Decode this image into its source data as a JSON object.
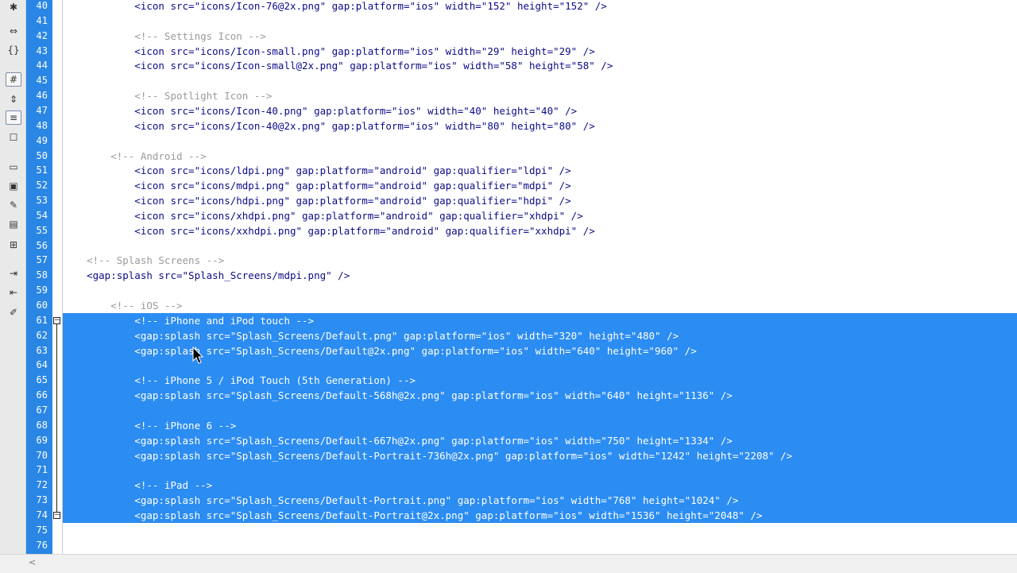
{
  "toolbar": {
    "icons": [
      "asterisk-icon",
      "collapse-tag-icon",
      "braces-icon",
      "line-numbers-icon",
      "collapse-icon",
      "word-wrap-icon",
      "syntax-check-icon",
      "comment-icon",
      "uncomment-icon",
      "highlight-icon",
      "wrap-tag-icon",
      "recent-snippets-icon",
      "indent-icon",
      "outdent-icon",
      "format-source-icon"
    ]
  },
  "editor": {
    "lines": [
      {
        "n": "40",
        "text": "            <icon src=\"icons/Icon-76@2x.png\" gap:platform=\"ios\" width=\"152\" height=\"152\" />",
        "kind": "code",
        "sel": false
      },
      {
        "n": "41",
        "text": "",
        "kind": "code",
        "sel": false
      },
      {
        "n": "42",
        "text": "            <!-- Settings Icon -->",
        "kind": "comment",
        "sel": false
      },
      {
        "n": "43",
        "text": "            <icon src=\"icons/Icon-small.png\" gap:platform=\"ios\" width=\"29\" height=\"29\" />",
        "kind": "code",
        "sel": false
      },
      {
        "n": "44",
        "text": "            <icon src=\"icons/Icon-small@2x.png\" gap:platform=\"ios\" width=\"58\" height=\"58\" />",
        "kind": "code",
        "sel": false
      },
      {
        "n": "45",
        "text": "",
        "kind": "code",
        "sel": false
      },
      {
        "n": "46",
        "text": "            <!-- Spotlight Icon -->",
        "kind": "comment",
        "sel": false
      },
      {
        "n": "47",
        "text": "            <icon src=\"icons/Icon-40.png\" gap:platform=\"ios\" width=\"40\" height=\"40\" />",
        "kind": "code",
        "sel": false
      },
      {
        "n": "48",
        "text": "            <icon src=\"icons/Icon-40@2x.png\" gap:platform=\"ios\" width=\"80\" height=\"80\" />",
        "kind": "code",
        "sel": false
      },
      {
        "n": "49",
        "text": "",
        "kind": "code",
        "sel": false
      },
      {
        "n": "50",
        "text": "        <!-- Android -->",
        "kind": "comment",
        "sel": false
      },
      {
        "n": "51",
        "text": "            <icon src=\"icons/ldpi.png\" gap:platform=\"android\" gap:qualifier=\"ldpi\" />",
        "kind": "code",
        "sel": false
      },
      {
        "n": "52",
        "text": "            <icon src=\"icons/mdpi.png\" gap:platform=\"android\" gap:qualifier=\"mdpi\" />",
        "kind": "code",
        "sel": false
      },
      {
        "n": "53",
        "text": "            <icon src=\"icons/hdpi.png\" gap:platform=\"android\" gap:qualifier=\"hdpi\" />",
        "kind": "code",
        "sel": false
      },
      {
        "n": "54",
        "text": "            <icon src=\"icons/xhdpi.png\" gap:platform=\"android\" gap:qualifier=\"xhdpi\" />",
        "kind": "code",
        "sel": false
      },
      {
        "n": "55",
        "text": "            <icon src=\"icons/xxhdpi.png\" gap:platform=\"android\" gap:qualifier=\"xxhdpi\" />",
        "kind": "code",
        "sel": false
      },
      {
        "n": "56",
        "text": "",
        "kind": "code",
        "sel": false
      },
      {
        "n": "57",
        "text": "    <!-- Splash Screens -->",
        "kind": "comment",
        "sel": false
      },
      {
        "n": "58",
        "text": "    <gap:splash src=\"Splash_Screens/mdpi.png\" />",
        "kind": "code",
        "sel": false
      },
      {
        "n": "59",
        "text": "",
        "kind": "code",
        "sel": false
      },
      {
        "n": "60",
        "text": "        <!-- iOS -->",
        "kind": "comment",
        "sel": false
      },
      {
        "n": "61",
        "text": "            <!-- iPhone and iPod touch -->",
        "kind": "comment",
        "sel": true
      },
      {
        "n": "62",
        "text": "            <gap:splash src=\"Splash_Screens/Default.png\" gap:platform=\"ios\" width=\"320\" height=\"480\" />",
        "kind": "code",
        "sel": true
      },
      {
        "n": "63",
        "text": "            <gap:splash src=\"Splash_Screens/Default@2x.png\" gap:platform=\"ios\" width=\"640\" height=\"960\" />",
        "kind": "code",
        "sel": true
      },
      {
        "n": "64",
        "text": "",
        "kind": "code",
        "sel": true
      },
      {
        "n": "65",
        "text": "            <!-- iPhone 5 / iPod Touch (5th Generation) -->",
        "kind": "comment",
        "sel": true
      },
      {
        "n": "66",
        "text": "            <gap:splash src=\"Splash_Screens/Default-568h@2x.png\" gap:platform=\"ios\" width=\"640\" height=\"1136\" />",
        "kind": "code",
        "sel": true
      },
      {
        "n": "67",
        "text": "",
        "kind": "code",
        "sel": true
      },
      {
        "n": "68",
        "text": "            <!-- iPhone 6 -->",
        "kind": "comment",
        "sel": true
      },
      {
        "n": "69",
        "text": "            <gap:splash src=\"Splash_Screens/Default-667h@2x.png\" gap:platform=\"ios\" width=\"750\" height=\"1334\" />",
        "kind": "code",
        "sel": true
      },
      {
        "n": "70",
        "text": "            <gap:splash src=\"Splash_Screens/Default-Portrait-736h@2x.png\" gap:platform=\"ios\" width=\"1242\" height=\"2208\" />",
        "kind": "code",
        "sel": true
      },
      {
        "n": "71",
        "text": "",
        "kind": "code",
        "sel": true
      },
      {
        "n": "72",
        "text": "            <!-- iPad -->",
        "kind": "comment",
        "sel": true
      },
      {
        "n": "73",
        "text": "            <gap:splash src=\"Splash_Screens/Default-Portrait.png\" gap:platform=\"ios\" width=\"768\" height=\"1024\" />",
        "kind": "code",
        "sel": true
      },
      {
        "n": "74",
        "text": "            <gap:splash src=\"Splash_Screens/Default-Portrait@2x.png\" gap:platform=\"ios\" width=\"1536\" height=\"2048\" />",
        "kind": "code",
        "sel": true
      },
      {
        "n": "75",
        "text": "",
        "kind": "code",
        "sel": false
      },
      {
        "n": "76",
        "text": "",
        "kind": "code",
        "sel": false
      }
    ]
  },
  "colors": {
    "gutter": "#2a86e4",
    "selection": "#2b8cf2",
    "code": "#0b0b8a",
    "comment": "#9a9a9a"
  }
}
